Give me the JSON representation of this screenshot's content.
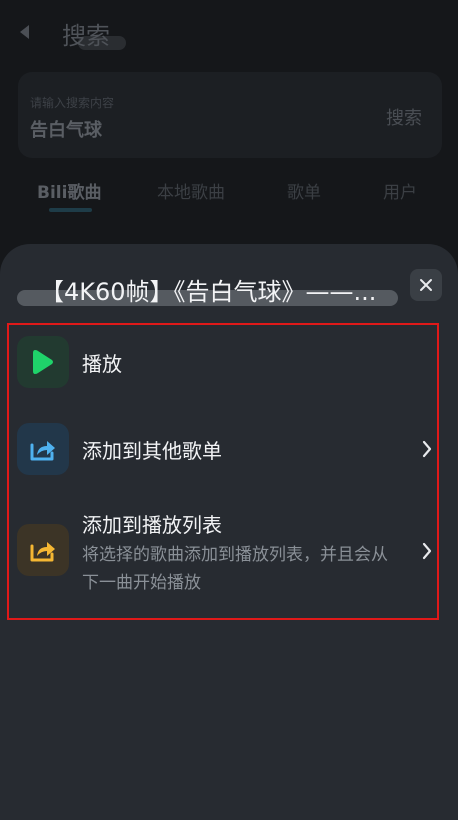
{
  "background": {
    "title": "搜索",
    "search": {
      "placeholder": "请输入搜索内容",
      "value": "告白气球",
      "button_label": "搜索"
    },
    "tabs": [
      {
        "label": "Bili歌曲",
        "active": true
      },
      {
        "label": "本地歌曲",
        "active": false
      },
      {
        "label": "歌单",
        "active": false
      },
      {
        "label": "用户",
        "active": false
      }
    ]
  },
  "sheet": {
    "title": "【4K60帧】《告白气球》——...",
    "close_icon": "close-icon",
    "items": [
      {
        "label": "播放",
        "icon": "play-icon",
        "icon_color": "#1fd36a",
        "icon_bg": "#223a30",
        "has_chevron": false
      },
      {
        "label": "添加到其他歌单",
        "icon": "share-icon",
        "icon_color": "#4fb2f0",
        "icon_bg": "#22374a",
        "has_chevron": true
      },
      {
        "label": "添加到播放列表",
        "description": "将选择的歌曲添加到播放列表，并且会从下一曲开始播放",
        "icon": "share-icon",
        "icon_color": "#f5b733",
        "icon_bg": "#3c3426",
        "has_chevron": true
      }
    ]
  },
  "colors": {
    "highlight": "#e01919",
    "sheet_bg": "#272b31"
  }
}
